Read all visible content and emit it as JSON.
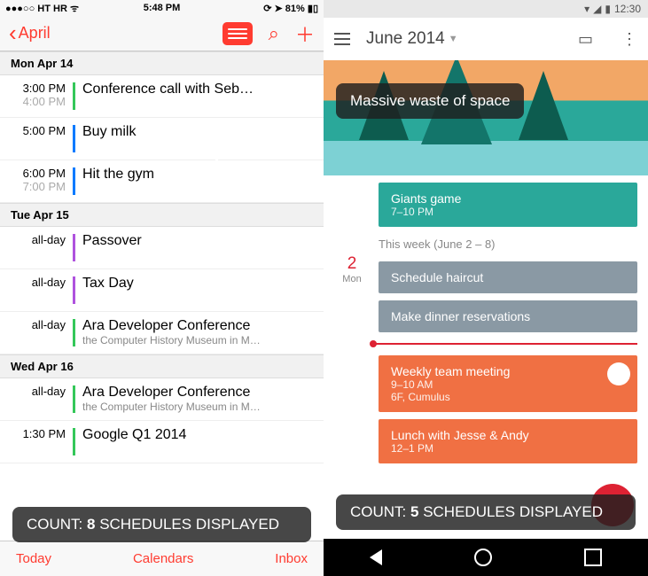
{
  "ios": {
    "status": {
      "carrier": "HT HR",
      "time": "5:48 PM",
      "battery": "81%"
    },
    "nav": {
      "back": "April"
    },
    "days": [
      {
        "header": "Mon  Apr 14",
        "events": [
          {
            "t1": "3:00 PM",
            "t2": "4:00 PM",
            "title": "Conference call with Seb…",
            "color": "#34C759"
          },
          {
            "t1": "5:00 PM",
            "t2": "",
            "title": "Buy milk",
            "color": "#007AFF"
          },
          {
            "t1": "6:00 PM",
            "t2": "7:00 PM",
            "title": "Hit the gym",
            "color": "#007AFF"
          }
        ]
      },
      {
        "header": "Tue  Apr 15",
        "events": [
          {
            "t1": "all-day",
            "t2": "",
            "title": "Passover",
            "color": "#AF52DE"
          },
          {
            "t1": "all-day",
            "t2": "",
            "title": "Tax Day",
            "color": "#AF52DE"
          },
          {
            "t1": "all-day",
            "t2": "",
            "title": "Ara Developer Conference",
            "sub": "the Computer History Museum in M…",
            "color": "#34C759"
          }
        ]
      },
      {
        "header": "Wed  Apr 16",
        "events": [
          {
            "t1": "all-day",
            "t2": "",
            "title": "Ara Developer Conference",
            "sub": "the Computer History Museum in M…",
            "color": "#34C759"
          },
          {
            "t1": "1:30 PM",
            "t2": "",
            "title": "Google Q1 2014",
            "color": "#34C759"
          }
        ]
      }
    ],
    "tabs": {
      "today": "Today",
      "calendars": "Calendars",
      "inbox": "Inbox"
    },
    "count_label": "COUNT: ",
    "count_val": "8",
    "count_suffix": " SCHEDULES DISPLAYED"
  },
  "android": {
    "status": {
      "time": "12:30"
    },
    "nav": {
      "title": "June 2014"
    },
    "hero_overlay": "Massive waste of space",
    "giants": {
      "title": "Giants game",
      "time": "7–10 PM",
      "color": "#2aa89a"
    },
    "week_label": "This week (June 2 – 8)",
    "day": {
      "num": "2",
      "name": "Mon"
    },
    "cards": [
      {
        "title": "Schedule haircut",
        "color": "#8a99a4"
      },
      {
        "title": "Make dinner reservations",
        "color": "#8a99a4"
      }
    ],
    "meeting": {
      "title": "Weekly team meeting",
      "time": "9–10 AM",
      "loc": "6F, Cumulus",
      "color": "#f07043"
    },
    "lunch": {
      "title": "Lunch with Jesse & Andy",
      "time": "12–1 PM",
      "color": "#f07043"
    },
    "count_label": "COUNT: ",
    "count_val": "5",
    "count_suffix": " SCHEDULES DISPLAYED"
  },
  "annotations": {
    "ios_row": "90px",
    "android_row": "110px"
  }
}
